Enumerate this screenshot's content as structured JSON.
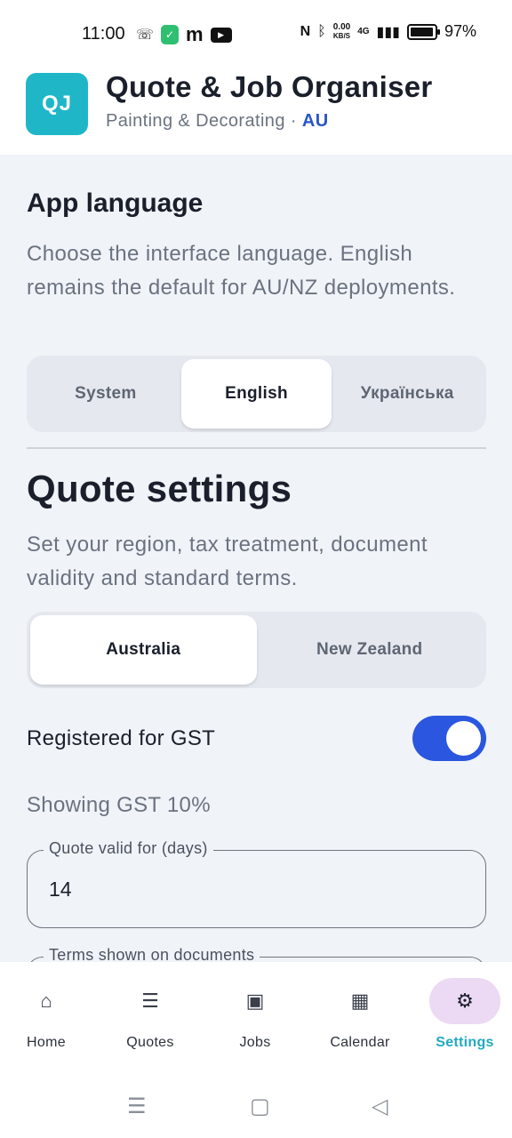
{
  "status_bar": {
    "time": "11:00",
    "data_speed": "0.00",
    "data_unit": "KB/S",
    "network": "4G",
    "battery": "97%",
    "battery_level": 0.97
  },
  "app": {
    "logo_text": "QJ",
    "title": "Quote & Job Organiser",
    "subtitle": "Painting & Decorating",
    "separator": "·",
    "region": "AU",
    "accent_color": "#1fb7c8"
  },
  "language": {
    "heading": "App language",
    "description": "Choose the interface language. English remains the default for AU/NZ deployments.",
    "options": [
      "System",
      "English",
      "Українська"
    ],
    "selected": "English"
  },
  "quote_settings": {
    "heading": "Quote settings",
    "description": "Set your region, tax treatment, document validity and standard terms.",
    "regions": [
      "Australia",
      "New Zealand"
    ],
    "selected_region": "Australia",
    "gst_label": "Registered for GST",
    "gst_enabled": true,
    "gst_note": "Showing GST 10%",
    "valid_days_label": "Quote valid for (days)",
    "valid_days_value": "14",
    "terms_label": "Terms shown on documents"
  },
  "bottom_nav": {
    "items": [
      {
        "label": "Home",
        "icon": "home-icon"
      },
      {
        "label": "Quotes",
        "icon": "list-icon"
      },
      {
        "label": "Jobs",
        "icon": "job-icon"
      },
      {
        "label": "Calendar",
        "icon": "calendar-icon"
      },
      {
        "label": "Settings",
        "icon": "settings-icon"
      }
    ],
    "active": "Settings"
  }
}
